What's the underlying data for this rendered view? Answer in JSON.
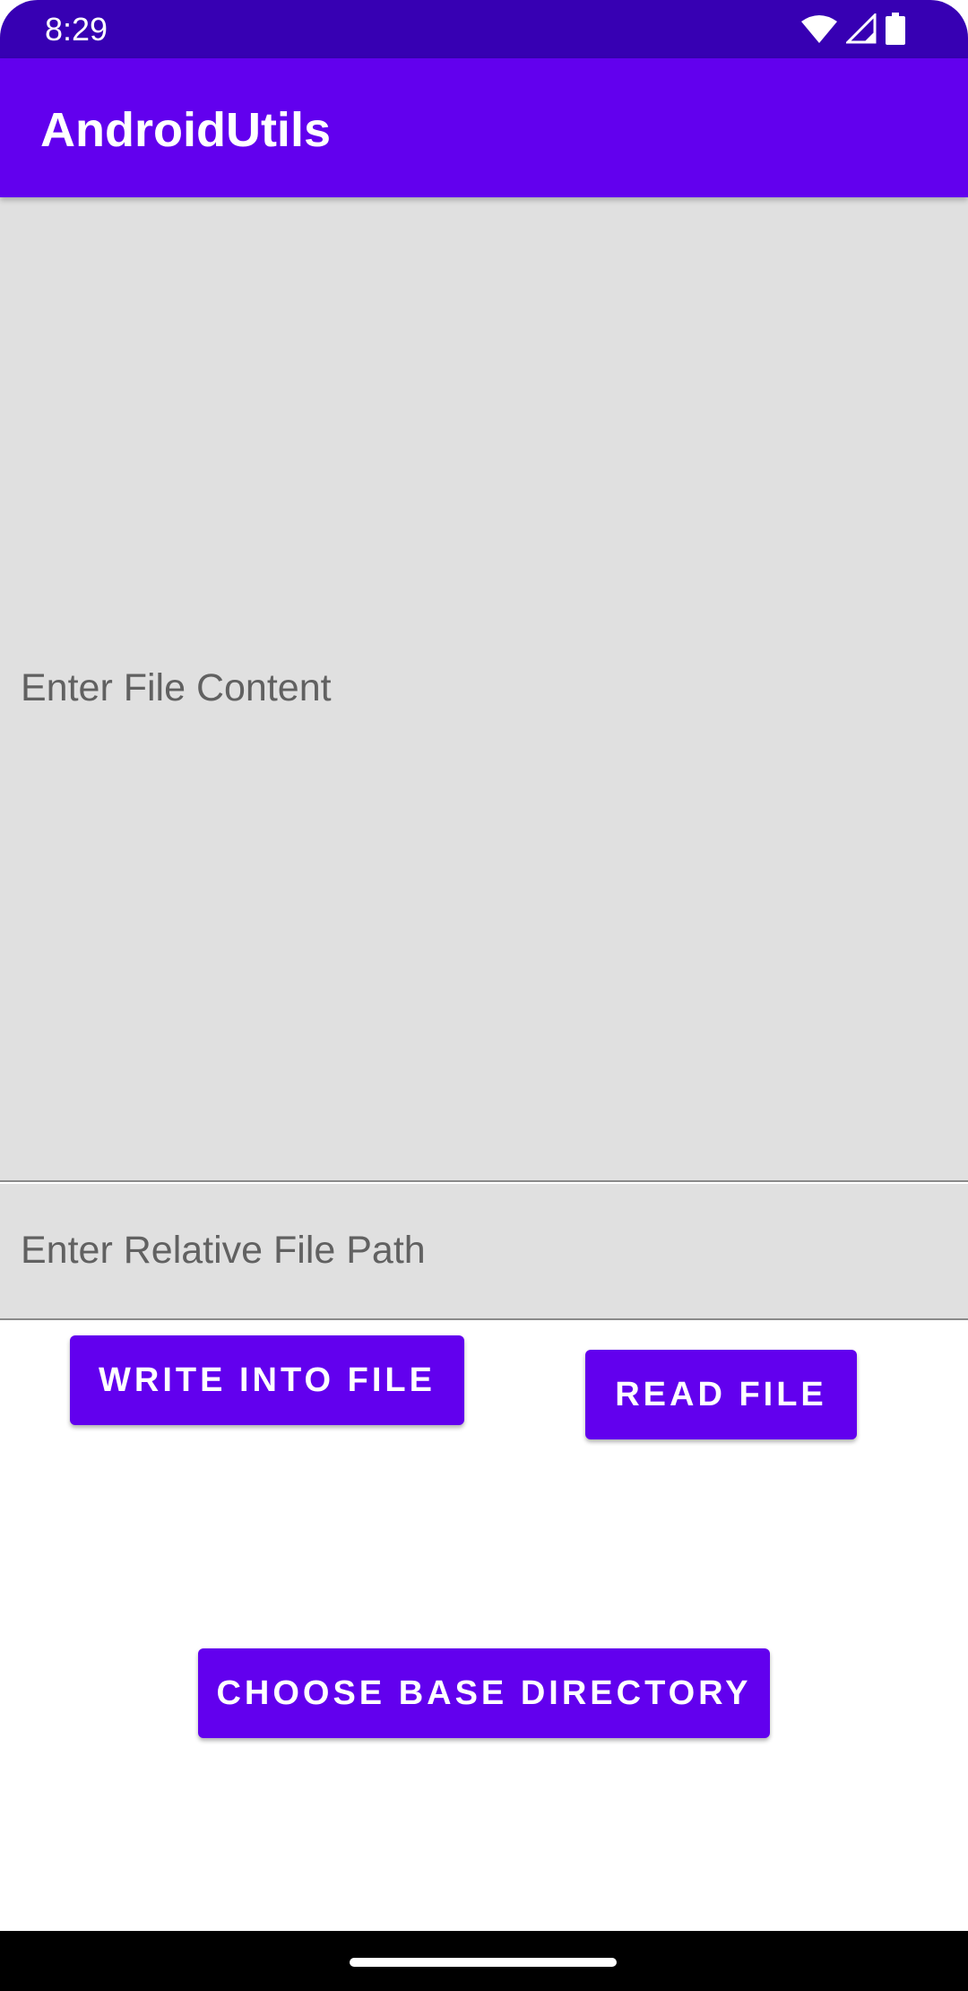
{
  "status_bar": {
    "time": "8:29",
    "icons": [
      "wifi-icon",
      "cellular-signal-icon",
      "battery-icon"
    ]
  },
  "app_bar": {
    "title": "AndroidUtils"
  },
  "content_input": {
    "value": "",
    "placeholder": "Enter File Content"
  },
  "path_input": {
    "value": "",
    "placeholder": "Enter Relative File Path"
  },
  "buttons": {
    "write": "WRITE INTO FILE",
    "read": "READ FILE",
    "choose_dir": "CHOOSE BASE DIRECTORY"
  },
  "colors": {
    "status_bar": "#3700b3",
    "primary": "#6200ee",
    "field_background": "#e0e0e0",
    "hint_text": "#616161"
  }
}
